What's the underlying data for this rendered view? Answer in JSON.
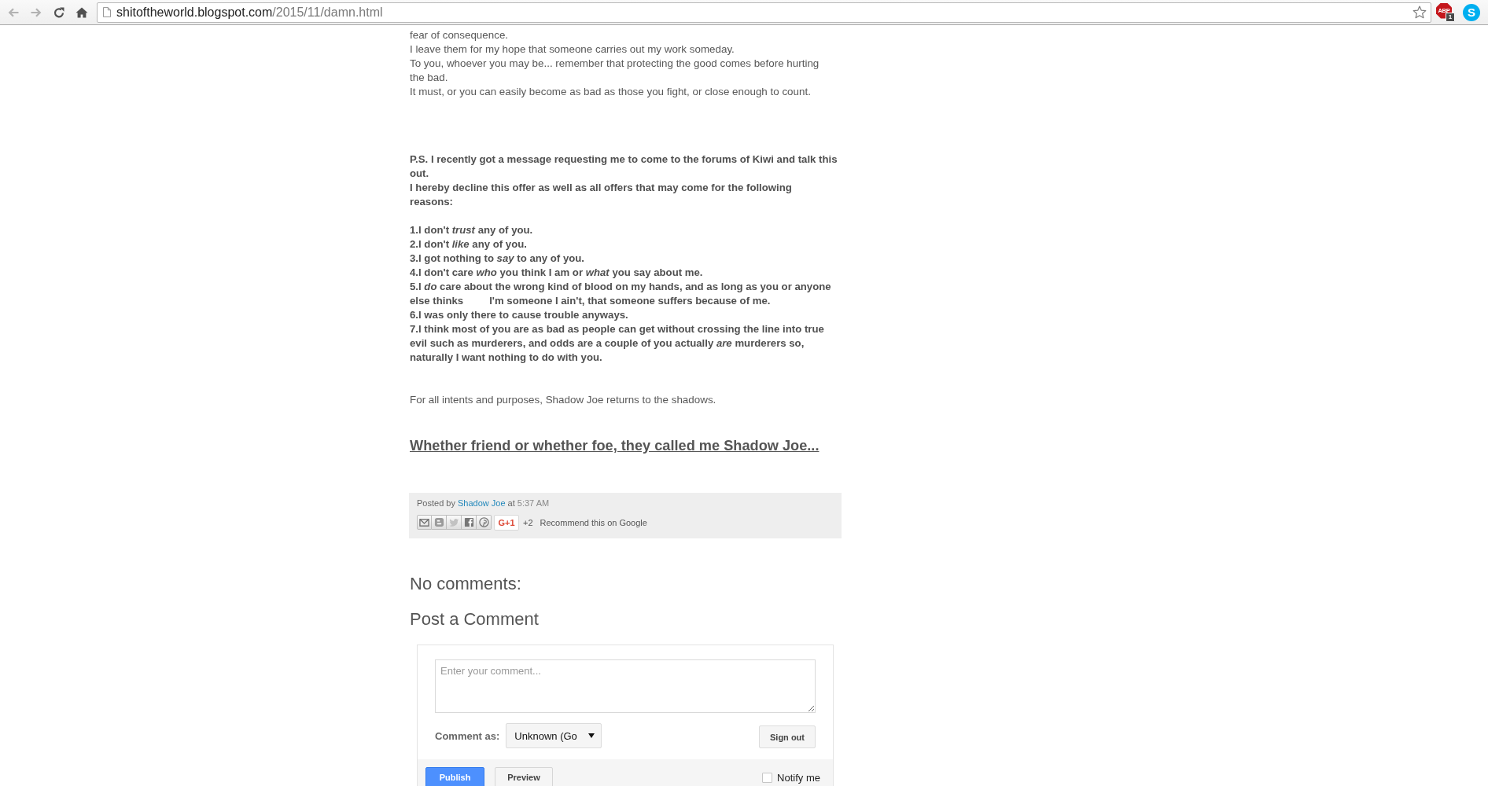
{
  "browser": {
    "address": {
      "host": "shitoftheworld.blogspot.com",
      "path": "/2015/11/damn.html"
    },
    "extensions": [
      {
        "kind": "octagon",
        "label": "ABP",
        "badge": "1"
      },
      {
        "kind": "round",
        "label": "S"
      }
    ]
  },
  "post": {
    "body": [
      {
        "kind": "plain",
        "lines": [
          "fear of consequence.",
          "I leave them for my hope that someone carries out my work someday.",
          "To you, whoever you may be... remember that protecting the good comes before hurting the bad.",
          "It must, or you can easily become as bad as those you fight, or close enough to count."
        ]
      },
      {
        "kind": "bold",
        "lines": [
          "P.S. I recently got a message requesting me to come to the forums of Kiwi and talk this out.",
          "I hereby decline this offer as well as all offers that may come for the following reasons:"
        ]
      },
      {
        "kind": "bold",
        "lines": [
          "1.I don't *trust* any of you.",
          "2.I don't *like* any of you.",
          "3.I got nothing to *say* to any of you.",
          "4.I don't care *who* you think I am or *what* you say about me.",
          "5.I *do* care about the wrong kind of blood on my hands, and as long as you or anyone else thinks         I'm someone I ain't, that someone suffers because of me.",
          "6.I was only there to cause trouble anyways.",
          "7.I think most of you are as bad as people can get without crossing the line into true evil such as murderers, and odds are a couple of you actually *are* murderers so, naturally I want nothing to do with you."
        ]
      },
      {
        "kind": "plain",
        "lines": [
          "For all intents and purposes, Shadow Joe returns to the shadows."
        ]
      }
    ],
    "title": "Whether friend or whether foe, they called me Shadow Joe...",
    "footer": {
      "byline": {
        "prefix": "Posted by",
        "author": "Shadow Joe",
        "joiner": "at",
        "time": "5:37 AM"
      },
      "plus_one": "G+1",
      "plus_count": "+2",
      "recommend": "Recommend this on Google"
    }
  },
  "comments": {
    "heading": "No comments:",
    "form_title": "Post a Comment",
    "form": {
      "placeholder": "Enter your comment...",
      "comment_as_label": "Comment as:",
      "identity": "Unknown (Go",
      "sign_out": "Sign out",
      "publish": "Publish",
      "preview": "Preview",
      "notify": {
        "label": "Notify me",
        "checked": false
      }
    }
  }
}
